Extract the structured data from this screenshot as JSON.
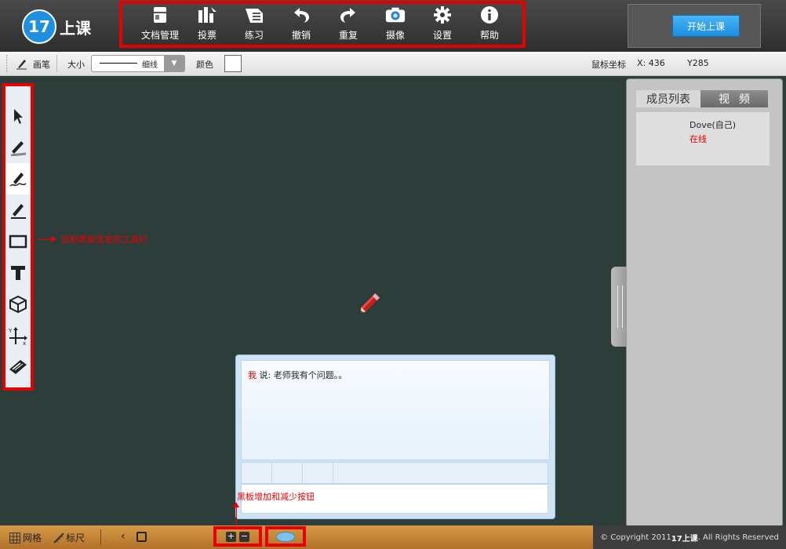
{
  "app": {
    "logo_number": "17",
    "logo_text": "上课"
  },
  "menu": [
    {
      "label": "文档管理",
      "icon": "document-manage-icon"
    },
    {
      "label": "投票",
      "icon": "vote-chart-icon"
    },
    {
      "label": "练习",
      "icon": "exercise-icon"
    },
    {
      "label": "撤销",
      "icon": "undo-icon"
    },
    {
      "label": "重复",
      "icon": "redo-icon"
    },
    {
      "label": "摄像",
      "icon": "camera-icon"
    },
    {
      "label": "设置",
      "icon": "gear-icon"
    },
    {
      "label": "帮助",
      "icon": "info-icon"
    }
  ],
  "start_button": "开始上课",
  "toolsbar": {
    "pen_label": "画笔",
    "size_label": "大小",
    "size_value": "细线",
    "color_label": "颜色",
    "coord_label": "鼠标坐标",
    "x": "X: 436",
    "y": "Y285"
  },
  "left_tools": [
    "pointer-icon",
    "highlighter-icon",
    "freehand-pen-icon",
    "line-pen-icon",
    "rectangle-icon",
    "text-icon",
    "cube-icon",
    "axis-icon",
    "eraser-icon"
  ],
  "annotations": {
    "toolbar_note": "绘制黑板信息的工具栏",
    "zoom_note": "黑板增加和减少按钮"
  },
  "right_panel": {
    "tab_members": "成员列表",
    "tab_video": "视频",
    "member_name": "Dove(自己)",
    "member_status": "在线"
  },
  "chat": {
    "speaker": "我",
    "message": "说: 老师我有个问题。。"
  },
  "bottom": {
    "grid_label": "网格",
    "ruler_label": "标尺",
    "zoom_in": "+",
    "zoom_out": "−",
    "copyright_prefix": "© Copyright  2011 ",
    "copyright_brand": "17上课",
    "copyright_suffix": ". All Rights Reserved"
  },
  "colors": {
    "accent_red": "#e60000",
    "board": "#2d3d3a",
    "start_blue": "#1b8fe0"
  }
}
